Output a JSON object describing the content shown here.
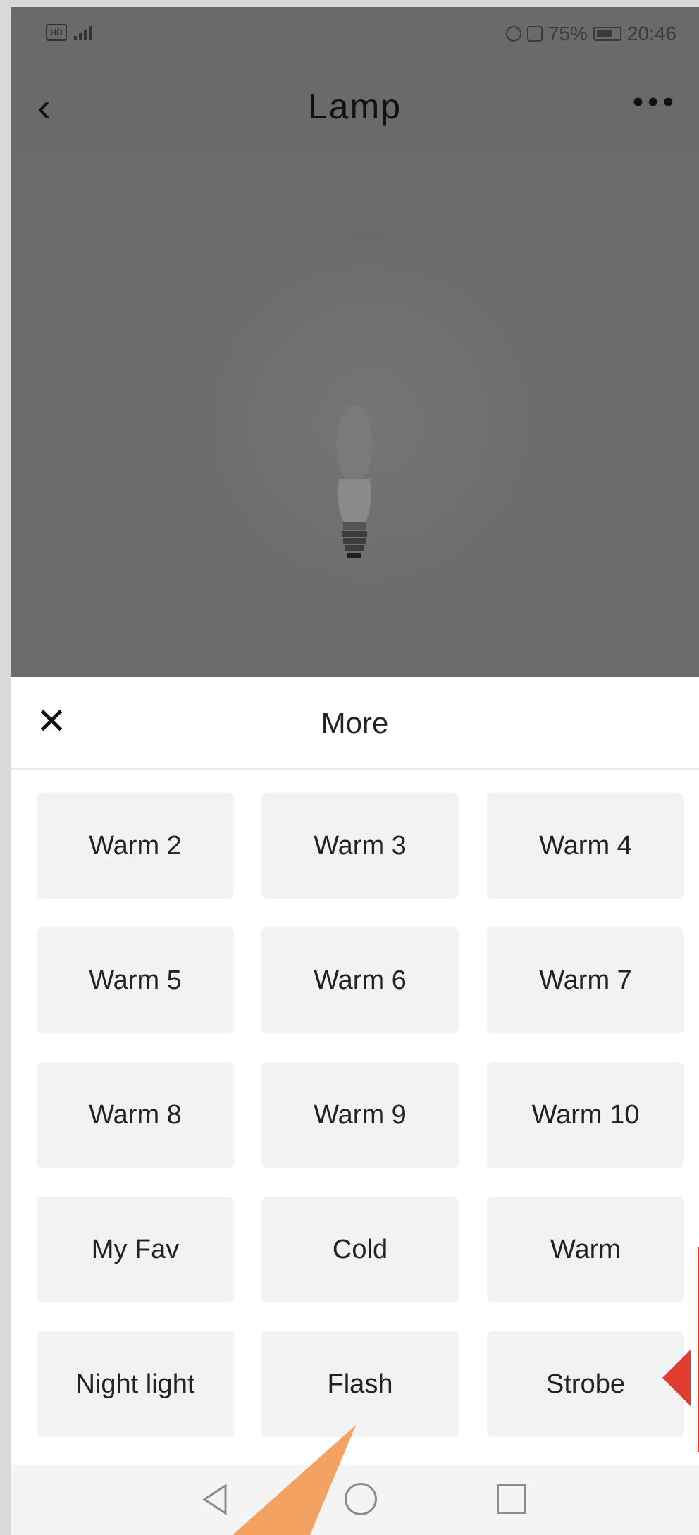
{
  "status_bar": {
    "hd": "HD",
    "network": "4G",
    "battery_percent": "75%",
    "time": "20:46"
  },
  "app_bar": {
    "title": "Lamp"
  },
  "sheet": {
    "title": "More",
    "scenes": [
      {
        "label": "Warm 2"
      },
      {
        "label": "Warm 3"
      },
      {
        "label": "Warm 4"
      },
      {
        "label": "Warm 5"
      },
      {
        "label": "Warm 6"
      },
      {
        "label": "Warm 7"
      },
      {
        "label": "Warm 8"
      },
      {
        "label": "Warm 9"
      },
      {
        "label": "Warm 10"
      },
      {
        "label": "My Fav"
      },
      {
        "label": "Cold"
      },
      {
        "label": "Warm"
      },
      {
        "label": "Night light"
      },
      {
        "label": "Flash"
      },
      {
        "label": "Strobe"
      }
    ]
  },
  "icons": {
    "back": "chevron-left-icon",
    "more": "more-dots-icon",
    "close": "close-icon",
    "nav_back": "triangle-back-icon",
    "nav_home": "circle-home-icon",
    "nav_recent": "square-recent-icon"
  },
  "colors": {
    "annotation_red": "#e03c31",
    "annotation_orange": "#f4a261"
  }
}
